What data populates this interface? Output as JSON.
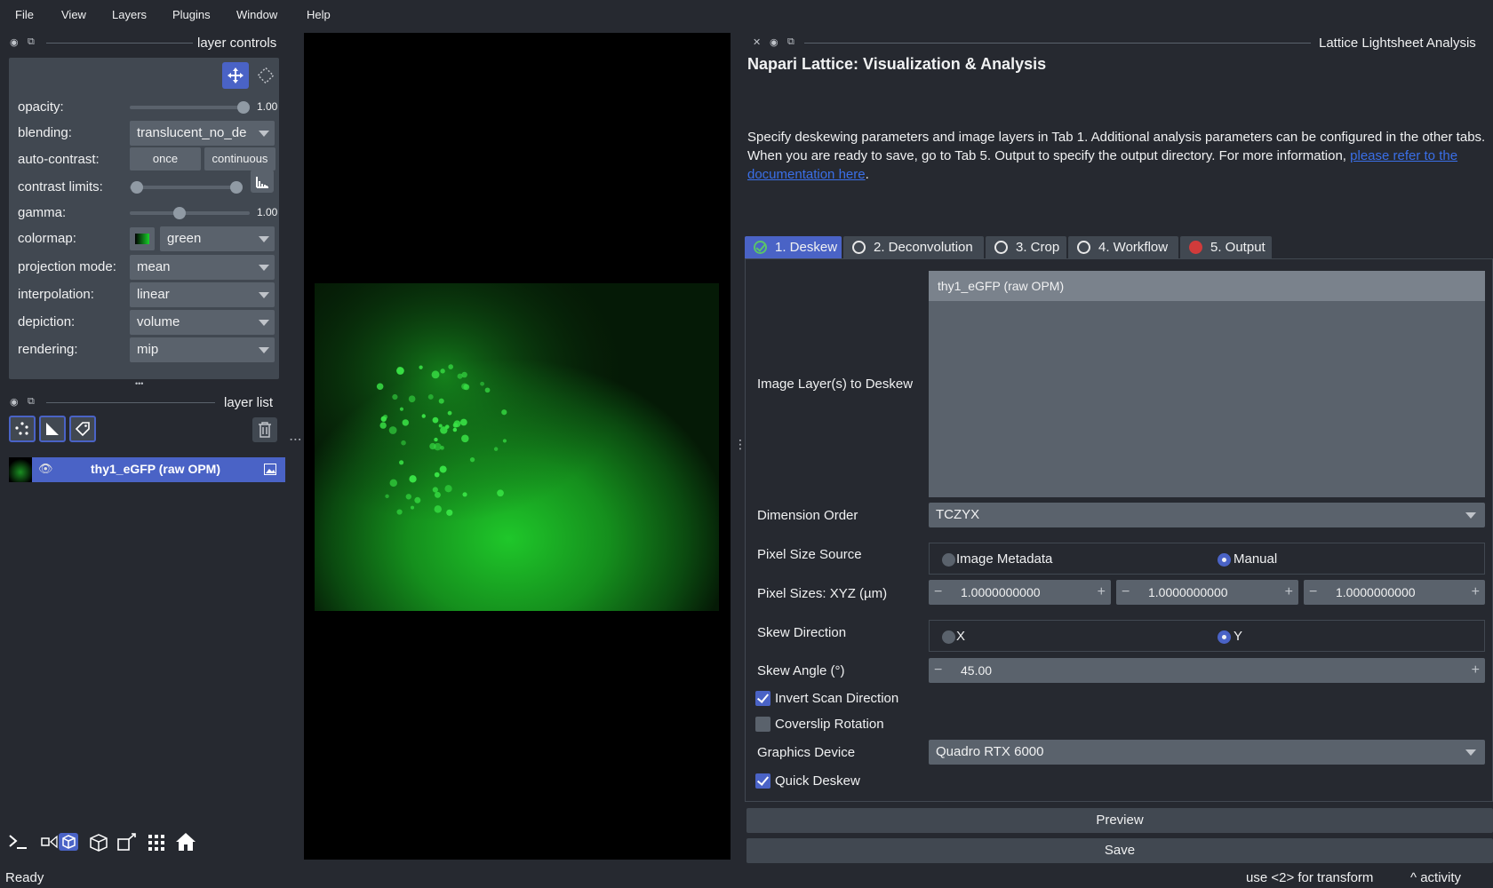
{
  "menu": [
    "File",
    "View",
    "Layers",
    "Plugins",
    "Window",
    "Help"
  ],
  "layer_controls": {
    "title": "layer controls",
    "opacity_label": "opacity:",
    "opacity_value": "1.00",
    "opacity_fraction": 1.0,
    "blending_label": "blending:",
    "blending_value": "translucent_no_de",
    "auto_contrast_label": "auto-contrast:",
    "once_label": "once",
    "continuous_label": "continuous",
    "contrast_limits_label": "contrast limits:",
    "gamma_label": "gamma:",
    "gamma_value": "1.00",
    "colormap_label": "colormap:",
    "colormap_value": "green",
    "projection_label": "projection mode:",
    "projection_value": "mean",
    "interpolation_label": "interpolation:",
    "interpolation_value": "linear",
    "depiction_label": "depiction:",
    "depiction_value": "volume",
    "rendering_label": "rendering:",
    "rendering_value": "mip",
    "more_label": "•••"
  },
  "layer_list": {
    "title": "layer list",
    "layers": [
      {
        "name": "thy1_eGFP (raw OPM)"
      }
    ]
  },
  "plugin": {
    "dock_title": "Lattice Lightsheet Analysis",
    "title": "Napari Lattice: Visualization & Analysis",
    "description": "Specify deskewing parameters and image layers in Tab 1.  Additional analysis parameters can be configured in the other tabs.  When you are ready to save, go to Tab 5.  Output to specify the output directory. For more information, ",
    "doc_link": "please refer to the documentation here",
    "description_end": ".",
    "tabs": [
      {
        "label": "1. Deskew",
        "status": "ok"
      },
      {
        "label": "2. Deconvolution",
        "status": "empty"
      },
      {
        "label": "3. Crop",
        "status": "empty"
      },
      {
        "label": "4. Workflow",
        "status": "empty"
      },
      {
        "label": "5. Output",
        "status": "error"
      }
    ],
    "image_layers_label": "Image Layer(s) to Deskew",
    "image_layers_selected": "thy1_eGFP (raw OPM)",
    "dimension_order_label": "Dimension Order",
    "dimension_order_value": "TCZYX",
    "pixel_size_source_label": "Pixel Size Source",
    "pixel_size_source_options": [
      "Image Metadata",
      "Manual"
    ],
    "pixel_size_source_selected": "Manual",
    "pixel_sizes_label": "Pixel Sizes: XYZ (µm)",
    "pixel_sizes": [
      "1.0000000000",
      "1.0000000000",
      "1.0000000000"
    ],
    "skew_direction_label": "Skew Direction",
    "skew_direction_options": [
      "X",
      "Y"
    ],
    "skew_direction_selected": "Y",
    "skew_angle_label": "Skew Angle (°)",
    "skew_angle_value": "45.00",
    "invert_scan_label": "Invert Scan Direction",
    "invert_scan_checked": true,
    "coverslip_label": "Coverslip Rotation",
    "coverslip_checked": false,
    "graphics_device_label": "Graphics Device",
    "graphics_device_value": "Quadro RTX 6000",
    "quick_deskew_label": "Quick Deskew",
    "quick_deskew_checked": true,
    "preview_label": "Preview",
    "save_label": "Save"
  },
  "status": {
    "left": "Ready",
    "hint": "use <2> for transform",
    "activity": "activity"
  },
  "colors": {
    "background": "#262930",
    "panel": "#414851",
    "control": "#5a626c",
    "accent": "#4a63c6",
    "ok": "#5ac46a",
    "error": "#d13b3b",
    "image_green": "#19d12a"
  }
}
